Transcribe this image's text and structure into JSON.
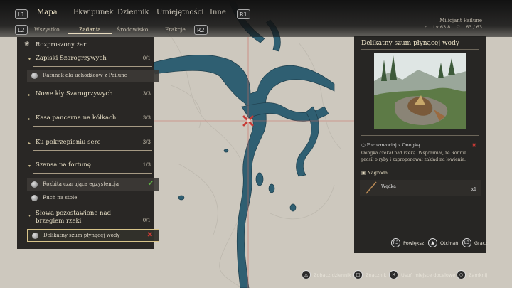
{
  "nav": {
    "l1": "L1",
    "r1": "R1",
    "l2": "L2",
    "r2": "R2",
    "tabs": [
      "Mapa",
      "Ekwipunek",
      "Dziennik",
      "Umiejętności",
      "Inne"
    ],
    "subtabs": [
      "Wszystko",
      "Zadania",
      "Środowisko",
      "Frakcje"
    ]
  },
  "player": {
    "name": "Milicjant Pailune",
    "level": "Lv 63.8",
    "health": "63 / 63"
  },
  "panel": {
    "title": "Rozproszony żar",
    "categories": [
      {
        "label": "Zapiski Szarogrzywych",
        "count": "0/1"
      },
      {
        "label": "Nowe kły Szarogrzywych",
        "count": "3/3"
      },
      {
        "label": "Kasa pancerna na kółkach",
        "count": "3/3"
      },
      {
        "label": "Ku pokrzepieniu serc",
        "count": "3/3"
      },
      {
        "label": "Szansa na fortunę",
        "count": "1/3"
      },
      {
        "label": "Słowa pozostawione nad brzegiem rzeki",
        "count": "0/1"
      }
    ],
    "quests": [
      {
        "label": "Ratunek dla uchodźców z Pailune"
      },
      {
        "label": "Rozbita czarująca egzystencja"
      },
      {
        "label": "Ruch na stole"
      },
      {
        "label": "Delikatny szum płynącej wody"
      }
    ]
  },
  "detail": {
    "title": "Delikatny szum płynącej wody",
    "objective": "Porozmawiaj z Oongką",
    "description": "Oongka czekał nad rzeką. Wspomniał, że Ronnie prosił o ryby i zaproponował zakład na łowienie.",
    "reward_label": "Nagroda",
    "reward_item": "Wędka",
    "reward_qty": "x1"
  },
  "hints": {
    "zoom": "Powiększ",
    "abyss": "Otchłań",
    "player": "Gracz",
    "journal": "Zobacz dziennik",
    "marker": "Znacznik",
    "remove": "Usuń miejsce docelowe",
    "close": "Zamknij",
    "r3": "R3",
    "l3": "L3"
  },
  "colors": {
    "water": "#2f5f72",
    "land": "#cfcac0",
    "panel": "#1c1b19",
    "accent": "#f1e6c9",
    "marker": "#c83a35",
    "check": "#5fb043"
  }
}
